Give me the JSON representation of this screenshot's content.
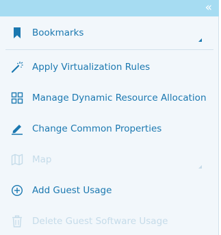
{
  "panel": {
    "collapse_glyph": "«",
    "bookmarks": {
      "label": "Bookmarks",
      "icon": "bookmark-icon"
    },
    "items": [
      {
        "label": "Apply Virtualization Rules",
        "icon": "magic-wand-icon",
        "enabled": true
      },
      {
        "label": "Manage Dynamic Resource Allocation",
        "icon": "grid-icon",
        "enabled": true
      },
      {
        "label": "Change Common Properties",
        "icon": "pencil-icon",
        "enabled": true
      },
      {
        "label": "Map",
        "icon": "map-icon",
        "enabled": false
      },
      {
        "label": "Add Guest Usage",
        "icon": "add-circle-icon",
        "enabled": true
      },
      {
        "label": "Delete Guest Software Usage",
        "icon": "trash-icon",
        "enabled": false
      }
    ]
  },
  "colors": {
    "accent": "#1b78b0",
    "disabled": "#c5dbe9",
    "topbar": "#a6dcf2",
    "background": "#f2f7fb"
  }
}
